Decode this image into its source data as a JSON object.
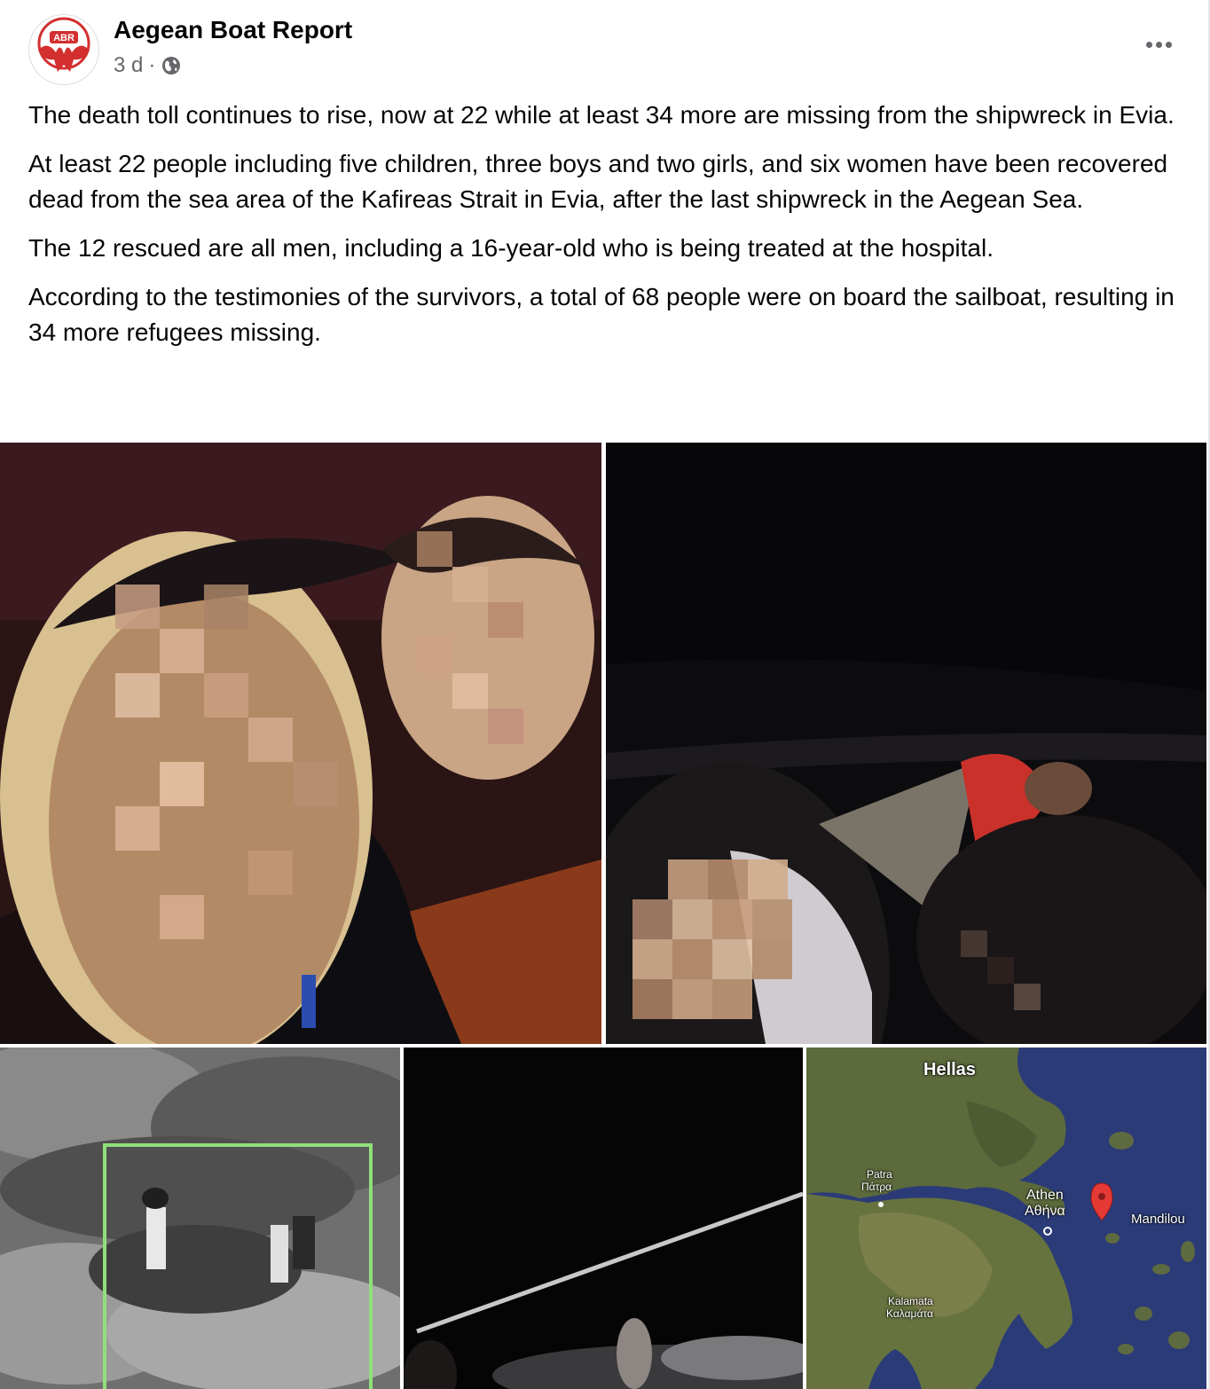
{
  "post": {
    "author": "Aegean Boat Report",
    "avatar_text": "ABR",
    "time": "3 d",
    "separator": "·",
    "visibility_icon": "globe-icon",
    "more_icon": "more-options-icon",
    "paragraphs": [
      "The death toll continues to rise, now at 22 while at least 34 more are missing from the shipwreck in Evia.",
      "At least 22 people including five children, three boys and two girls, and six women have been recovered dead from the sea area of the Kafireas Strait in Evia, after the last shipwreck in the Aegean Sea.",
      "The 12 rescued are all men, including a 16-year-old who is being treated at the hospital.",
      "According to the testimonies of the survivors, a total of 68 people were on board the sailboat, resulting in 34 more refugees missing."
    ]
  },
  "map": {
    "title": "Hellas",
    "patra_latin": "Patra",
    "patra_greek": "Πάτρα",
    "athens_latin": "Athen",
    "athens_greek": "Αθήνα",
    "kalamata_latin": "Kalamata",
    "kalamata_greek": "Καλαμάτα",
    "pin_label": "Mandilou",
    "pin_color": "#e53935"
  },
  "colors": {
    "text": "#050505",
    "secondary_text": "#65676b",
    "brand_red": "#d32f2f",
    "detection_box": "#8fe07a"
  }
}
